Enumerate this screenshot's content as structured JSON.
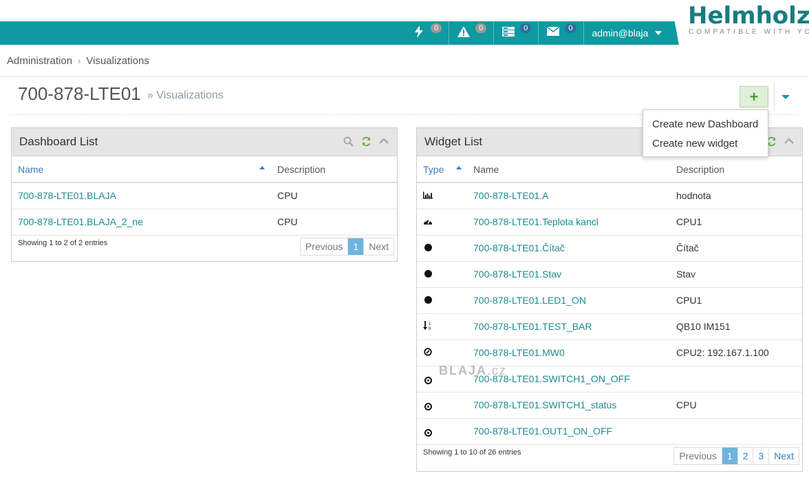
{
  "header": {
    "logo_text": "Helmholz",
    "logo_sub": "COMPATIBLE WITH YOU",
    "nav": [
      {
        "icon": "lightning-icon",
        "badge": "0",
        "badge_color": "#999999"
      },
      {
        "icon": "warning-icon",
        "badge": "0",
        "badge_color": "#999999"
      },
      {
        "icon": "server-icon",
        "badge": "0",
        "badge_color": "#2a6f9e"
      },
      {
        "icon": "envelope-icon",
        "badge": "0",
        "badge_color": "#2a6f9e"
      }
    ],
    "user": "admin@blaja",
    "accent_color": "#0e9aa0"
  },
  "breadcrumb": {
    "items": [
      "Administration",
      "Visualizations"
    ]
  },
  "page": {
    "title": "700-878-LTE01",
    "subtitle": "» Visualizations"
  },
  "dropdown": {
    "items": [
      "Create new Dashboard",
      "Create new widget"
    ]
  },
  "dashboard_list": {
    "title": "Dashboard List",
    "columns": [
      "Name",
      "Description"
    ],
    "rows": [
      {
        "name": "700-878-LTE01.BLAJA",
        "description": "CPU"
      },
      {
        "name": "700-878-LTE01.BLAJA_2_ne",
        "description": "CPU"
      }
    ],
    "showing": "Showing 1 to 2 of 2 entries",
    "pager": {
      "prev": "Previous",
      "pages": [
        "1"
      ],
      "next": "Next"
    }
  },
  "widget_list": {
    "title": "Widget List",
    "columns": [
      "Type",
      "Name",
      "Description"
    ],
    "rows": [
      {
        "type_icon": "bar-chart-icon",
        "name": "700-878-LTE01.A",
        "description": "hodnota"
      },
      {
        "type_icon": "dashboard-gauge-icon",
        "name": "700-878-LTE01.Teplota kancl",
        "description": "CPU1"
      },
      {
        "type_icon": "circle-icon",
        "name": "700-878-LTE01.Čítač",
        "description": "Čítač"
      },
      {
        "type_icon": "circle-icon",
        "name": "700-878-LTE01.Stav",
        "description": "Stav"
      },
      {
        "type_icon": "circle-icon",
        "name": "700-878-LTE01.LED1_ON",
        "description": "CPU1"
      },
      {
        "type_icon": "sort-numeric-icon",
        "name": "700-878-LTE01.TEST_BAR",
        "description": "QB10 IM151"
      },
      {
        "type_icon": "dial-icon",
        "name": "700-878-LTE01.MW0",
        "description": "CPU2: 192.167.1.100"
      },
      {
        "type_icon": "dot-circle-icon",
        "name": "700-878-LTE01.SWITCH1_ON_OFF",
        "description": ""
      },
      {
        "type_icon": "dot-circle-icon",
        "name": "700-878-LTE01.SWITCH1_status",
        "description": "CPU"
      },
      {
        "type_icon": "dot-circle-icon",
        "name": "700-878-LTE01.OUT1_ON_OFF",
        "description": ""
      }
    ],
    "showing": "Showing 1 to 10 of 26 entries",
    "pager": {
      "prev": "Previous",
      "pages": [
        "1",
        "2",
        "3"
      ],
      "next": "Next"
    }
  },
  "watermark": {
    "main": "BLAJA",
    "suffix": ".cz"
  }
}
